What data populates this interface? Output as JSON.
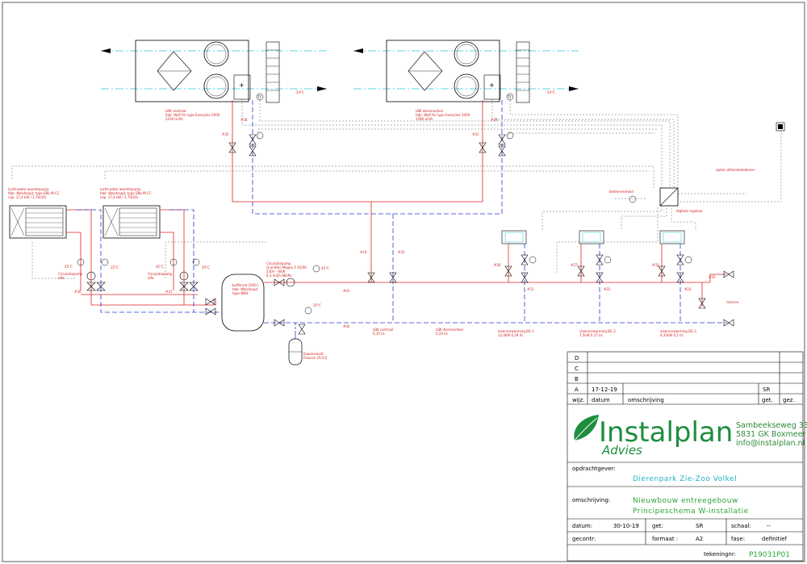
{
  "diagram": {
    "ahu": [
      {
        "label": "LBK centraal",
        "model": "fabr. Wolf Air type Everyline 2000",
        "flow": "2250 m3/h",
        "temp": "24°C",
        "sensor": "TT",
        "valve": "#20"
      },
      {
        "label": "LBK dierenartsen",
        "model": "fabr. Wolf Air type Everyline 1000",
        "flow": "1580 m3/h",
        "temp": "24°C",
        "sensor": "TT",
        "valve": "#22"
      }
    ],
    "heat_pumps": [
      {
        "title": "lucht-water warmtepomp",
        "model": "fabr. Weishaupt, type ENL-M-CC",
        "cap": "cap. 17,4 kW / 1.74(50)",
        "pump": "Circulatiepomp",
        "pump2": "alfa",
        "t_supply": "45°C",
        "t_return": "35°C",
        "valve": "#30"
      },
      {
        "title": "lucht-water warmtepomp",
        "model": "fabr. Weishaupt, type ENL-M-CC",
        "cap": "cap. 17,4 kW / 1.74(50)",
        "pump": "Circulatiepomp",
        "pump2": "alfa",
        "t_supply": "45°C",
        "t_return": "35°C",
        "valve": "#31"
      }
    ],
    "buffer": {
      "label": "buffervat 1500 l",
      "make": "fabr. Weishaupt",
      "type": "type WBS"
    },
    "circ_pump": {
      "label": "Circulatiepomp",
      "model": "Grundfos Magna 3  25/60",
      "power": "230V - 84W",
      "flow": "4,3 m3/h  80kPa",
      "temp": "45°C"
    },
    "expansion": {
      "label": "Expansievat",
      "model": "Flexcon 35-0,5",
      "temp": "35°C"
    },
    "flows": [
      "LBK centraal",
      "0,35 l/s",
      "LBK dierenartsen",
      "0,24 l/s"
    ],
    "floor_groups": [
      {
        "label": "vloerverwarming BG 1",
        "flow": "12,4kW  0,29 l/s",
        "valve": "#21"
      },
      {
        "label": "vloerverwarming BG 2",
        "flow": "7,5kW  0,17 l/s",
        "valve": "#22"
      },
      {
        "label": "vloerverwarming BG 3",
        "flow": "4,35kW  0,1 l/s",
        "valve": "#23"
      }
    ],
    "controls": {
      "outdoor": "opties afstandsbediener",
      "room": "bedieneenheid",
      "regulator": "digitale regelaar",
      "reserve": "reserve"
    },
    "tags": [
      "#28",
      "#29",
      "#24",
      "#25",
      "#26",
      "#27",
      "#32",
      "#33",
      "#41",
      "#42"
    ]
  },
  "title_block": {
    "revisions": [
      {
        "rev": "D",
        "date": "",
        "desc": "",
        "by": ""
      },
      {
        "rev": "C",
        "date": "",
        "desc": "",
        "by": ""
      },
      {
        "rev": "B",
        "date": "",
        "desc": "",
        "by": ""
      },
      {
        "rev": "A",
        "date": "17-12-19",
        "desc": "",
        "by": "SR"
      }
    ],
    "rev_headers": {
      "rev": "wijz.",
      "date": "datum",
      "desc": "omschrijving",
      "by": "get.",
      "check": "gez."
    },
    "company": {
      "name": "Instalplan",
      "sub": "Advies",
      "address1": "Sambeekseweg 33",
      "address2": "5831 GK  Boxmeer",
      "email": "info@instalplan.nl"
    },
    "client_label": "opdrachtgever:",
    "client": "Dierenpark  Zie-Zoo  Volkel",
    "desc_label": "omschrijving:",
    "desc1": "Nieuwbouw  entreegebouw",
    "desc2": "Principeschema  W-installatie",
    "date_label": "datum:",
    "date": "30-10-19",
    "drawn_label": "get:",
    "drawn": "SR",
    "scale_label": "schaal:",
    "scale": "--",
    "check_label": "gecontr:",
    "format_label": "formaat :",
    "format": "A2",
    "phase_label": "fase:",
    "phase": "definitief",
    "drawing_label": "tekeningnr:",
    "drawing": "P19031P01"
  },
  "colors": {
    "supply": "#e02424",
    "return": "#2a38d8",
    "air": "#27c6d6",
    "logo": "#1e8e3e"
  }
}
